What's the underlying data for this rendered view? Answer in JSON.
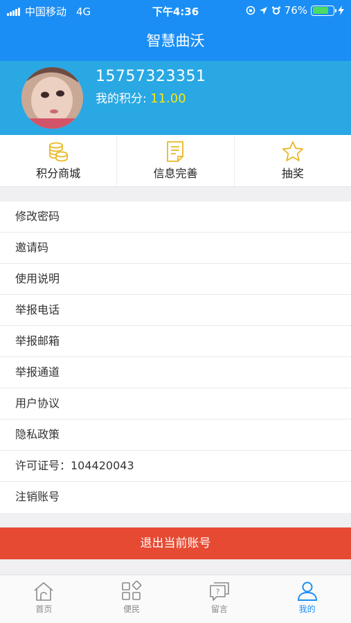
{
  "status_bar": {
    "carrier": "中国移动",
    "network": "4G",
    "time": "下午4:36",
    "battery": "76%",
    "battery_level": 0.76
  },
  "nav": {
    "title": "智慧曲沃"
  },
  "profile": {
    "phone": "15757323351",
    "points_label": "我的积分: ",
    "points_value": "11.00"
  },
  "quick_actions": [
    {
      "label": "积分商城",
      "icon": "coins-icon"
    },
    {
      "label": "信息完善",
      "icon": "document-icon"
    },
    {
      "label": "抽奖",
      "icon": "star-icon"
    }
  ],
  "menu": [
    {
      "label": "修改密码"
    },
    {
      "label": "邀请码"
    },
    {
      "label": "使用说明"
    },
    {
      "label": "举报电话"
    },
    {
      "label": "举报邮箱"
    },
    {
      "label": "举报通道"
    },
    {
      "label": "用户协议"
    },
    {
      "label": "隐私政策"
    },
    {
      "label": "许可证号：104420043"
    },
    {
      "label": "注销账号"
    }
  ],
  "logout_label": "退出当前账号",
  "tabs": [
    {
      "label": "首页",
      "icon": "home-icon"
    },
    {
      "label": "便民",
      "icon": "grid-icon"
    },
    {
      "label": "留言",
      "icon": "message-icon"
    },
    {
      "label": "我的",
      "icon": "person-icon",
      "active": true
    }
  ],
  "colors": {
    "primary": "#1a8ef5",
    "profile_bg": "#29a8e3",
    "points": "#f5e51b",
    "icon_gold": "#e9b824",
    "logout": "#e64a33"
  }
}
